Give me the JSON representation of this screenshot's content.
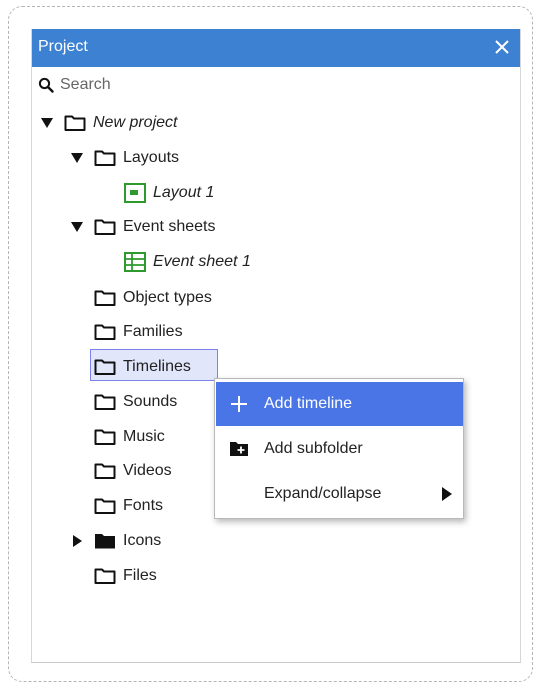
{
  "panel": {
    "title": "Project"
  },
  "search": {
    "placeholder": "Search"
  },
  "tree": {
    "root": "New project",
    "layouts": "Layouts",
    "layout1": "Layout 1",
    "event_sheets": "Event sheets",
    "event_sheet1": "Event sheet 1",
    "object_types": "Object types",
    "families": "Families",
    "timelines": "Timelines",
    "sounds": "Sounds",
    "music": "Music",
    "videos": "Videos",
    "fonts": "Fonts",
    "icons": "Icons",
    "files": "Files"
  },
  "context_menu": {
    "add_timeline": "Add timeline",
    "add_subfolder": "Add subfolder",
    "expand_collapse": "Expand/collapse"
  },
  "colors": {
    "header_blue": "#3d82d2",
    "menu_highlight": "#4a75e6",
    "selection_fill": "#e1e6fb",
    "icon_green": "#2e9a2e"
  }
}
